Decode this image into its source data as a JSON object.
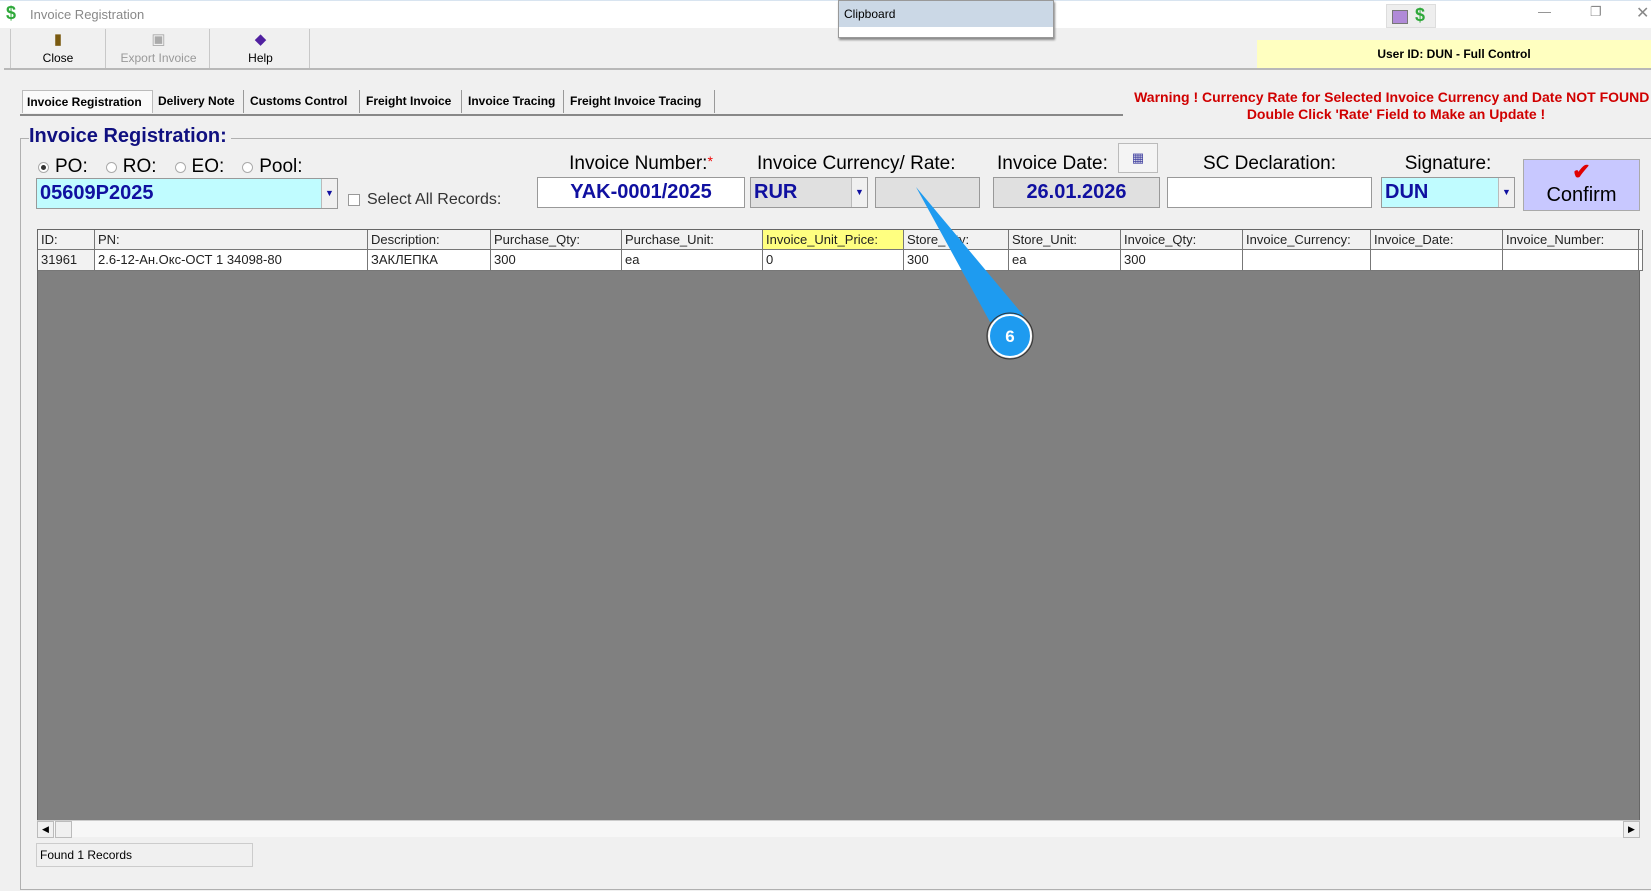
{
  "window": {
    "title": "Invoice Registration",
    "clipboard": "Clipboard",
    "user_id": "User ID: DUN - Full Control"
  },
  "toolbar": {
    "close": "Close",
    "export": "Export Invoice",
    "help": "Help"
  },
  "tabs": [
    "Invoice Registration",
    "Delivery Note",
    "Customs Control",
    "Freight Invoice",
    "Invoice Tracing",
    "Freight Invoice Tracing"
  ],
  "warning": "Warning ! Currency Rate for Selected Invoice Currency and Date NOT FOUND ! Double Click 'Rate' Field to Make an Update !",
  "form": {
    "title": "Invoice Registration:",
    "radios": [
      "PO:",
      "RO:",
      "EO:",
      "Pool:"
    ],
    "selected_radio": "PO:",
    "order_value": "05609P2025",
    "select_all_label": "Select All Records:",
    "invoice_number_label": "Invoice Number:",
    "required_mark": "*",
    "invoice_number": "YAK-0001/2025",
    "currency_label": "Invoice Currency/ Rate:",
    "currency": "RUR",
    "rate": "",
    "date_label": "Invoice Date:",
    "date": "26.01.2026",
    "sc_label": "SC Declaration:",
    "sc_value": "",
    "signature_label": "Signature:",
    "signature": "DUN",
    "confirm": "Confirm"
  },
  "grid": {
    "columns": [
      "ID:",
      "PN:",
      "Description:",
      "Purchase_Qty:",
      "Purchase_Unit:",
      "Invoice_Unit_Price:",
      "Store_Qty:",
      "Store_Unit:",
      "Invoice_Qty:",
      "Invoice_Currency:",
      "Invoice_Date:",
      "Invoice_Number:",
      ""
    ],
    "rows": [
      [
        "31961",
        "2.6-12-Ан.Окс-ОСТ 1 34098-80",
        "ЗАКЛЕПКА",
        "300",
        "ea",
        "0",
        "300",
        "ea",
        "300",
        "",
        "",
        "",
        ""
      ]
    ]
  },
  "status": "Found 1 Records",
  "callout": {
    "number": "6",
    "color": "#1e9bf0"
  },
  "colors": {
    "highlight_header": "#ffff80",
    "accent_blue": "#1010a0",
    "warning": "#d00000"
  }
}
